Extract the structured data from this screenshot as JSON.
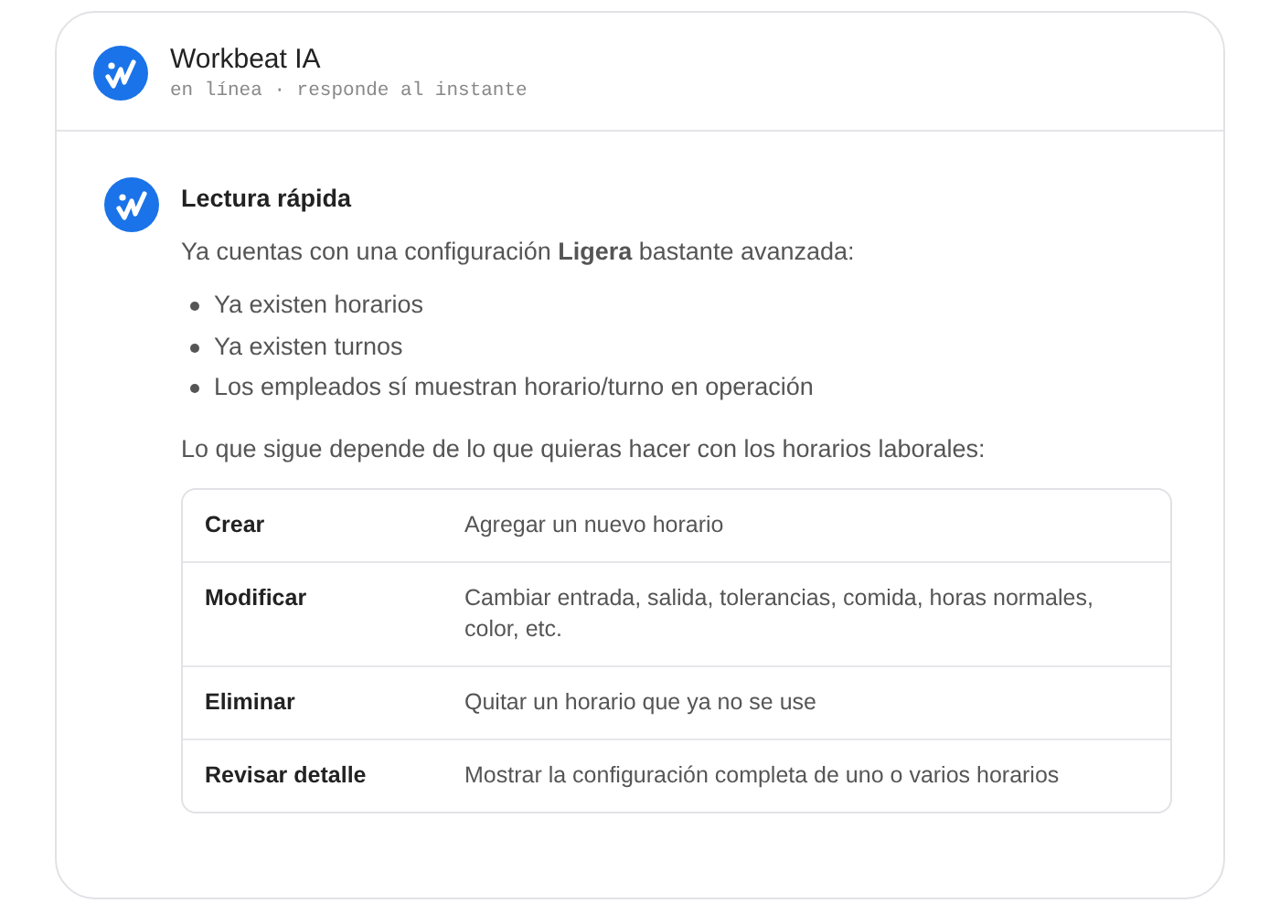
{
  "header": {
    "title": "Workbeat IA",
    "status": "en línea · responde al instante"
  },
  "message": {
    "title": "Lectura rápida",
    "intro": "Ya cuentas con una configuración **Ligera** bastante avanzada:",
    "bullets": [
      "Ya existen horarios",
      "Ya existen turnos",
      "Los empleados sí muestran horario/turno en operación"
    ],
    "lead": "Lo que sigue depende de lo que quieras hacer con los horarios laborales:",
    "table": {
      "rows": [
        {
          "action": "Crear",
          "description": "Agregar un nuevo horario"
        },
        {
          "action": "Modificar",
          "description": "Cambiar entrada, salida, tolerancias, comida, horas normales, color, etc."
        },
        {
          "action": "Eliminar",
          "description": "Quitar un horario que ya no se use"
        },
        {
          "action": "Revisar detalle",
          "description": "Mostrar la configuración completa de uno o varios horarios"
        }
      ]
    }
  }
}
